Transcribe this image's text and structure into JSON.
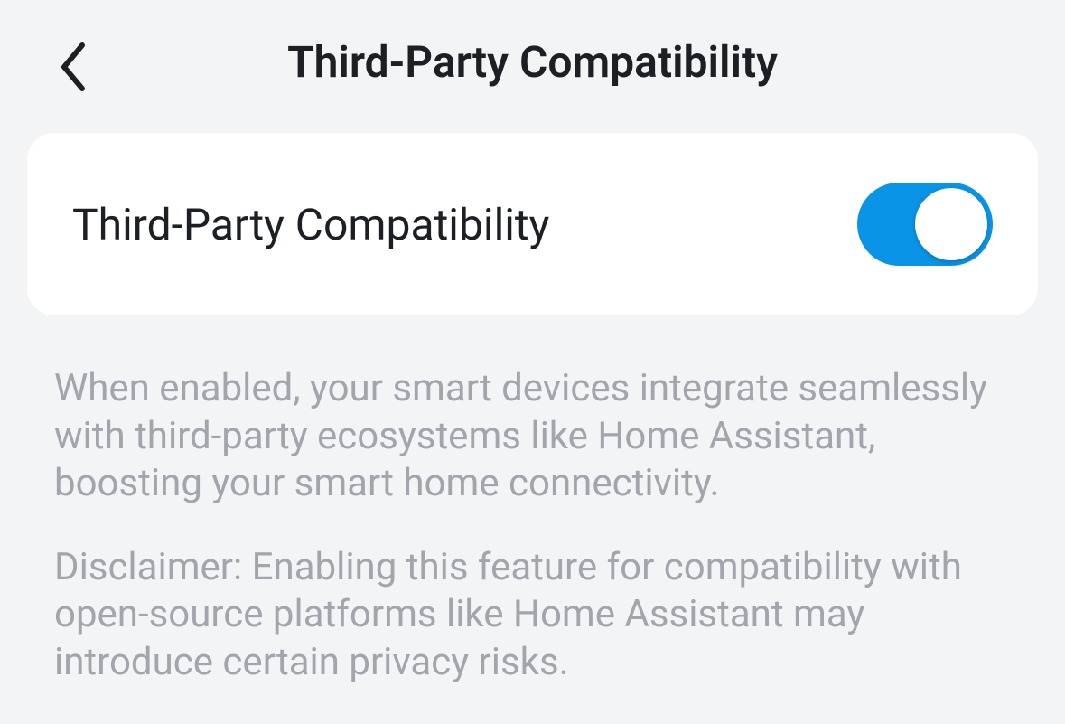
{
  "header": {
    "title": "Third-Party Compatibility"
  },
  "setting": {
    "label": "Third-Party Compatibility",
    "enabled": true
  },
  "description": {
    "para1": "When enabled, your smart devices integrate seamlessly with third-party ecosystems like Home Assistant, boosting your smart home connectivity.",
    "para2": "Disclaimer: Enabling this feature for compatibility with open-source platforms like Home Assistant may introduce certain privacy risks."
  },
  "colors": {
    "toggle_on": "#0a94e7"
  }
}
